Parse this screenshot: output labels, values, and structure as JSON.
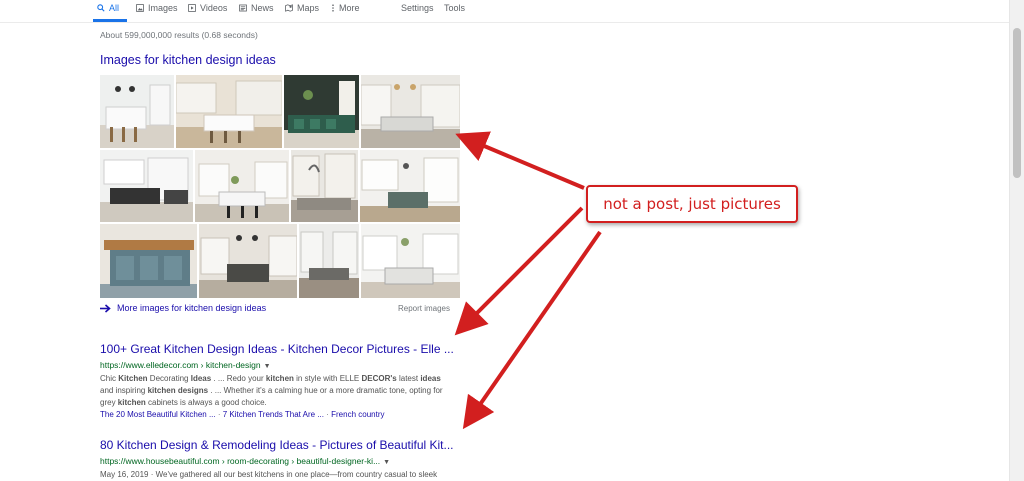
{
  "tabs": [
    {
      "label": "All",
      "icon": "search-icon"
    },
    {
      "label": "Images",
      "icon": "image-icon"
    },
    {
      "label": "Videos",
      "icon": "play-icon"
    },
    {
      "label": "News",
      "icon": "news-icon"
    },
    {
      "label": "Maps",
      "icon": "map-icon"
    },
    {
      "label": "More",
      "icon": "dots-vertical-icon"
    }
  ],
  "tools": {
    "settings": "Settings",
    "tools": "Tools"
  },
  "stats": "About 599,000,000 results (0.68 seconds)",
  "images_heading": "Images for kitchen design ideas",
  "more_images": "More images for kitchen design ideas",
  "report_images": "Report images",
  "results": [
    {
      "title": "100+ Great Kitchen Design Ideas - Kitchen Decor Pictures - Elle ...",
      "url": "https://www.elledecor.com › kitchen-design",
      "snippet_line1_html": "Chic <b>Kitchen</b> Decorating <b>Ideas</b> . ... Redo your <b>kitchen</b> in style with ELLE <b>DECOR's</b> latest <b>ideas</b>",
      "snippet_line2_html": "and inspiring <b>kitchen designs</b> . ... Whether it's a calming hue or a more dramatic tone, opting for",
      "snippet_line3_html": "grey <b>kitchen</b> cabinets is always a good choice.",
      "sitelinks": [
        "The 20 Most Beautiful Kitchen ...",
        "7 Kitchen Trends That Are ...",
        "French country"
      ]
    },
    {
      "title": "80 Kitchen Design & Remodeling Ideas - Pictures of Beautiful Kit...",
      "url": "https://www.housebeautiful.com › room-decorating › beautiful-designer-ki...",
      "snippet_line1_html": "May 16, 2019 · We've gathered all our best kitchens in one place—from country casual to sleek"
    }
  ],
  "callout": "not a post, just pictures",
  "colors": {
    "link": "#1a0dab",
    "url": "#006621",
    "accent": "#1a73e8",
    "annotation": "#d21f1f"
  }
}
